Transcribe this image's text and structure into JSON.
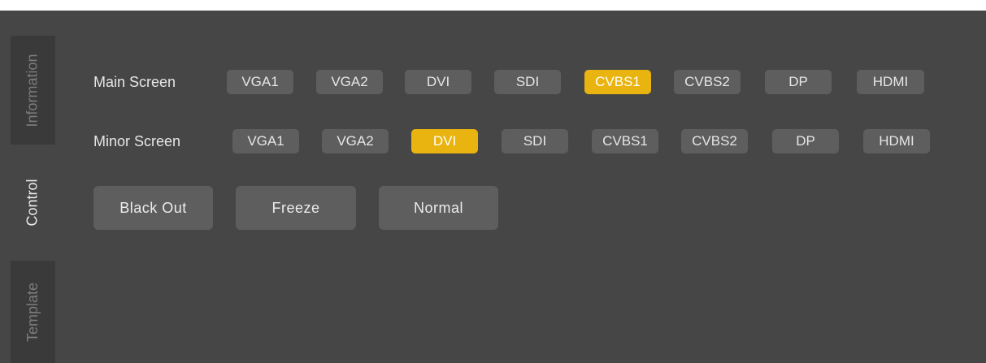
{
  "tabs": [
    {
      "label": "Information",
      "active": false
    },
    {
      "label": "Control",
      "active": true
    },
    {
      "label": "Template",
      "active": false
    }
  ],
  "main_screen": {
    "label": "Main Screen",
    "sources": [
      "VGA1",
      "VGA2",
      "DVI",
      "SDI",
      "CVBS1",
      "CVBS2",
      "DP",
      "HDMI"
    ],
    "selected": "CVBS1"
  },
  "minor_screen": {
    "label": "Minor Screen",
    "sources": [
      "VGA1",
      "VGA2",
      "DVI",
      "SDI",
      "CVBS1",
      "CVBS2",
      "DP",
      "HDMI"
    ],
    "selected": "DVI"
  },
  "actions": {
    "black_out": "Black Out",
    "freeze": "Freeze",
    "normal": "Normal"
  },
  "colors": {
    "background": "#464646",
    "button": "#5e5e5e",
    "selected": "#e9b40f"
  }
}
